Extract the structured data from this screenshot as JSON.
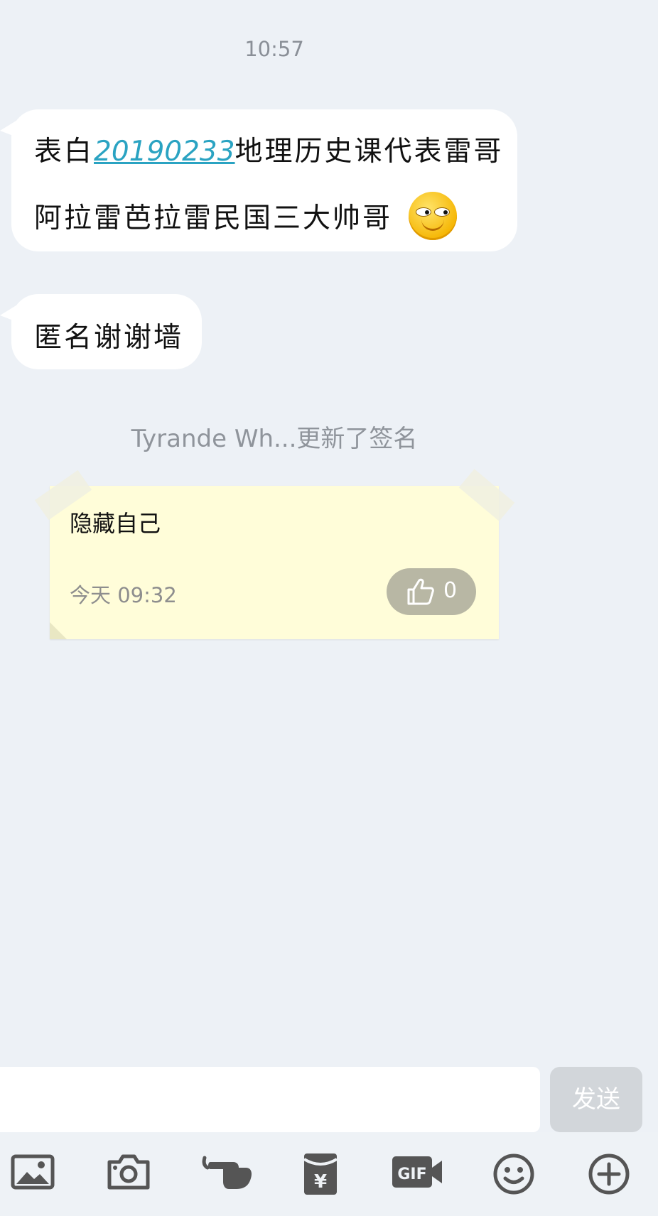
{
  "chat": {
    "timestamp": "10:57",
    "message1": {
      "prefix": "表白",
      "number": "20190233",
      "suffix": "地理历史课代表雷哥",
      "line2": "阿拉雷芭拉雷民国三大帅哥"
    },
    "message2": "匿名谢谢墙",
    "system_note": "Tyrande Wh...更新了签名"
  },
  "signature_card": {
    "text": "隐藏自己",
    "time": "今天 09:32",
    "like_count": "0"
  },
  "input": {
    "value": "",
    "send_label": "发送"
  },
  "toolbar": {
    "gif_label": "GIF",
    "icons": [
      "image-icon",
      "camera-icon",
      "poke-hand-icon",
      "red-packet-icon",
      "gif-icon",
      "emoji-icon",
      "plus-icon"
    ]
  }
}
